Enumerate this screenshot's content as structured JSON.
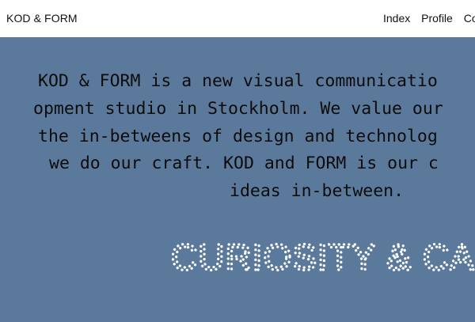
{
  "header": {
    "logo": "KOD & FORM",
    "nav": [
      "Index",
      "Profile",
      "Co"
    ]
  },
  "intro": {
    "lines": [
      "KOD & FORM is a new visual communicatio",
      "opment studio in Stockholm. We value our",
      "the in-betweens of design and technolog",
      "we do our craft. KOD and FORM is our c",
      "ideas in-between."
    ]
  },
  "tagline": "CURIOSITY & CARE",
  "colors": {
    "background": "#5b7a9b",
    "header": "#ffffff",
    "text": "#0c0c0c",
    "tagline": "#ffffff"
  }
}
